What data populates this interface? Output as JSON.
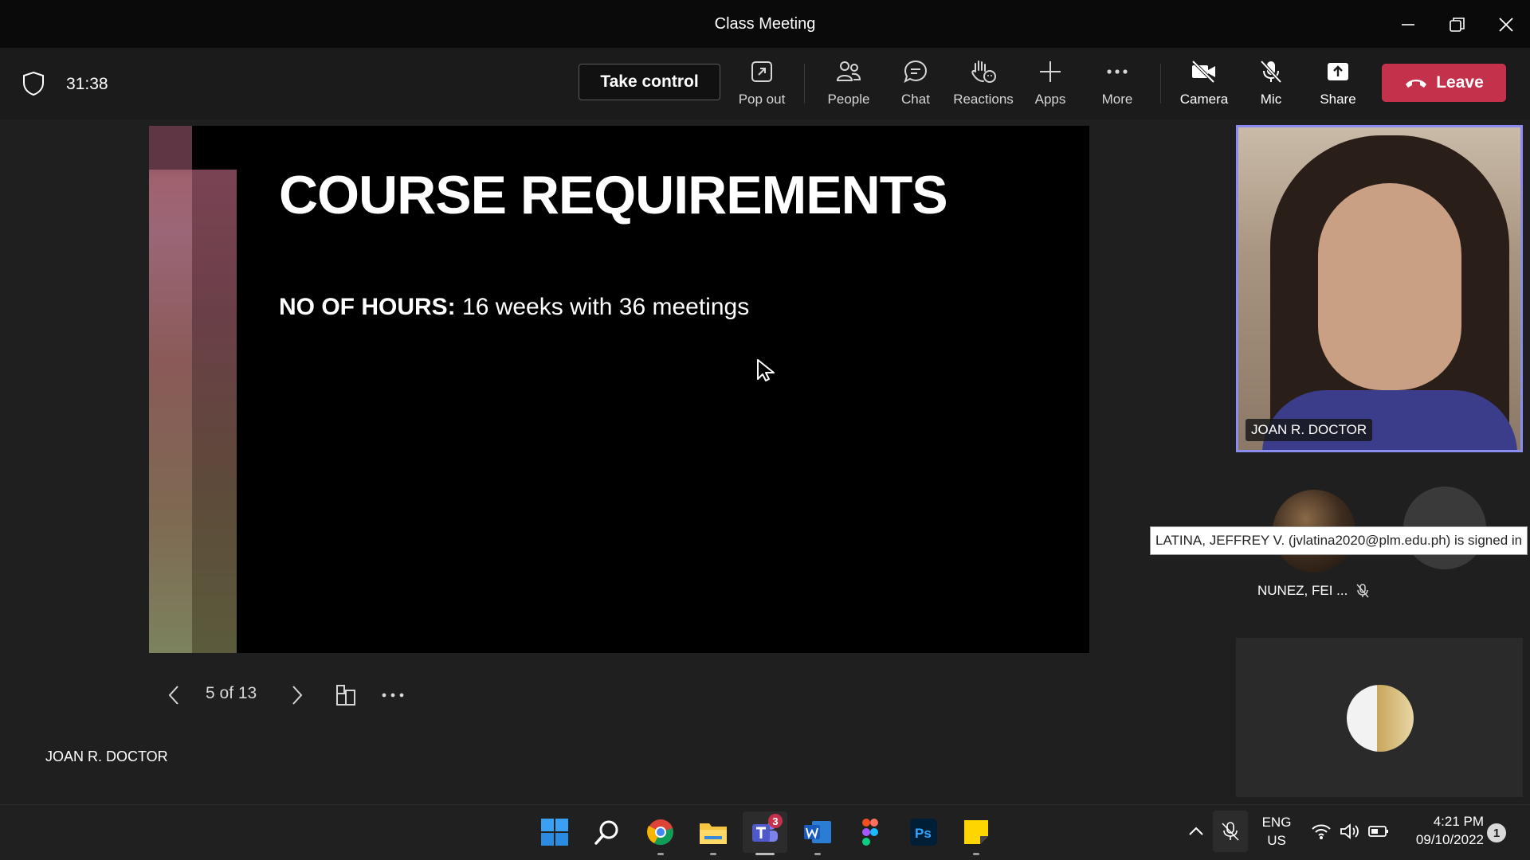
{
  "window": {
    "title": "Class Meeting"
  },
  "toolbar": {
    "timer": "31:38",
    "take_control": "Take control",
    "pop_out": "Pop out",
    "people": "People",
    "chat": "Chat",
    "reactions": "Reactions",
    "apps": "Apps",
    "more": "More",
    "camera": "Camera",
    "mic": "Mic",
    "share": "Share",
    "leave": "Leave",
    "leave_color": "#c4314b"
  },
  "slide": {
    "title": "COURSE REQUIREMENTS",
    "line_label": "NO OF HOURS:",
    "line_value": " 16 weeks with 36 meetings",
    "page_indicator": "5 of 13",
    "presenter": "JOAN R. DOCTOR"
  },
  "participants": {
    "main_name": "JOAN R. DOCTOR",
    "active_border_color": "#8b8cf0",
    "tooltip": "LATINA, JEFFREY V. (jvlatina2020@plm.edu.ph) is signed in",
    "second_name": "NUNEZ, FEI ..."
  },
  "taskbar": {
    "teams_badge": "3",
    "lang_top": "ENG",
    "lang_bottom": "US",
    "time": "4:21 PM",
    "date": "09/10/2022",
    "notification_count": "1"
  }
}
